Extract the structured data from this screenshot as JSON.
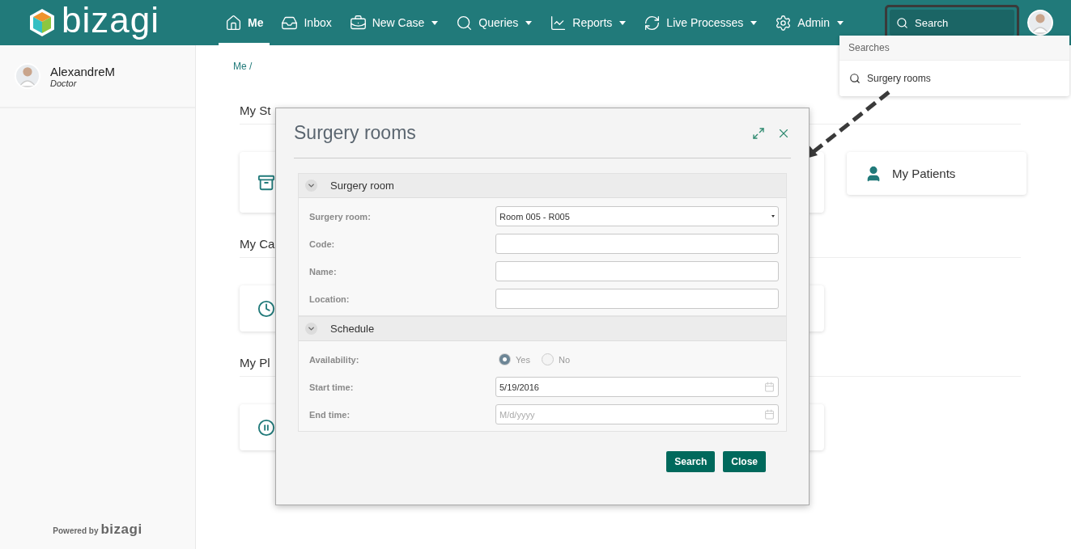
{
  "header": {
    "logo": "bizagi",
    "nav": [
      {
        "label": "Me",
        "selected": true,
        "has_menu": false
      },
      {
        "label": "Inbox",
        "selected": false,
        "has_menu": false
      },
      {
        "label": "New Case",
        "selected": false,
        "has_menu": true
      },
      {
        "label": "Queries",
        "selected": false,
        "has_menu": true
      },
      {
        "label": "Reports",
        "selected": false,
        "has_menu": true
      },
      {
        "label": "Live Processes",
        "selected": false,
        "has_menu": true
      },
      {
        "label": "Admin",
        "selected": false,
        "has_menu": true
      }
    ],
    "search": {
      "placeholder": "Search"
    },
    "search_history": {
      "heading": "Searches",
      "items": [
        "Surgery rooms"
      ]
    }
  },
  "sidebar": {
    "user": {
      "name": "AlexandreM",
      "role": "Doctor"
    },
    "footer": {
      "powered": "Powered by",
      "brand": "bizagi"
    }
  },
  "breadcrumb": "Me /",
  "sections": [
    {
      "heading": "My St",
      "cards": [
        {
          "kind": "archive"
        },
        {
          "kind": "patients",
          "label": "My Patients"
        }
      ]
    },
    {
      "heading": "My Ca",
      "cards": [
        {
          "kind": "clock"
        }
      ]
    },
    {
      "heading": "My Pl",
      "cards": [
        {
          "kind": "pause"
        }
      ]
    }
  ],
  "modal": {
    "title": "Surgery rooms",
    "groups": [
      {
        "title": "Surgery room",
        "expanded": true,
        "fields": [
          {
            "kind": "select",
            "label": "Surgery room:",
            "value": "Room 005 - R005"
          },
          {
            "kind": "text",
            "label": "Code:"
          },
          {
            "kind": "text",
            "label": "Name:"
          },
          {
            "kind": "text",
            "label": "Location:"
          }
        ]
      },
      {
        "title": "Schedule",
        "expanded": true,
        "fields": [
          {
            "kind": "radio",
            "label": "Availability:",
            "options": [
              {
                "label": "Yes",
                "selected": true
              },
              {
                "label": "No",
                "selected": false
              }
            ]
          },
          {
            "kind": "date",
            "label": "Start time:",
            "value": "5/19/2016"
          },
          {
            "kind": "date",
            "label": "End time:",
            "placeholder": "M/d/yyyy"
          }
        ]
      }
    ],
    "buttons": [
      "Search",
      "Close"
    ]
  }
}
